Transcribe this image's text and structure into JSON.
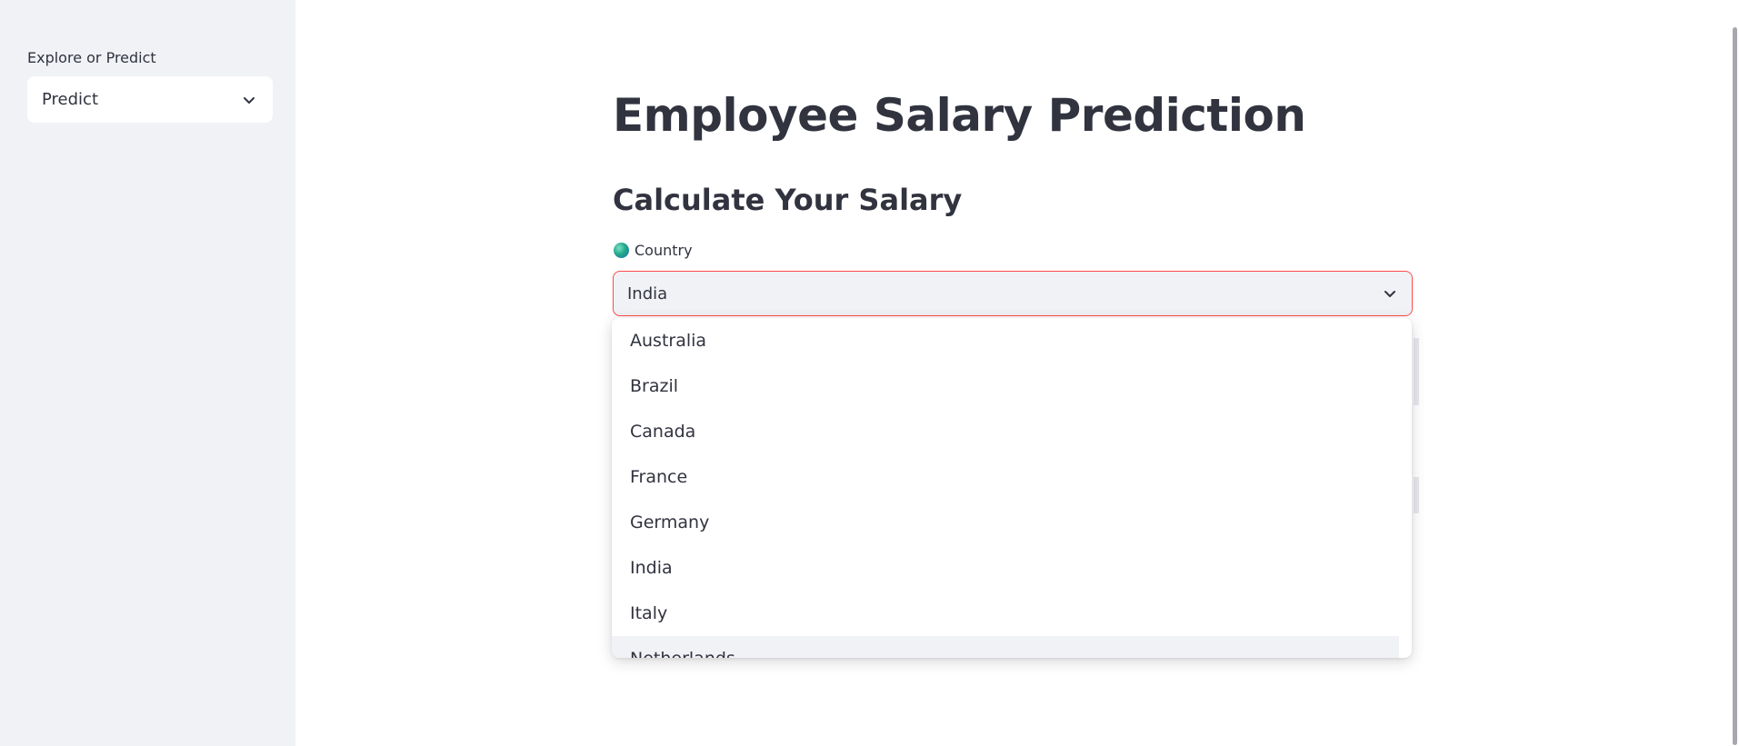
{
  "sidebar": {
    "label": "Explore or Predict",
    "selected": "Predict",
    "icon": "chevron-down-icon"
  },
  "main": {
    "title": "Employee Salary Prediction",
    "subtitle": "Calculate Your Salary",
    "country_field": {
      "icon": "globe-icon",
      "label": "Country",
      "value": "India",
      "options": [
        "Australia",
        "Brazil",
        "Canada",
        "France",
        "Germany",
        "India",
        "Italy",
        "Netherlands"
      ]
    }
  },
  "colors": {
    "accent_border": "#ff4b4b",
    "sidebar_bg": "#f0f2f6",
    "text": "#31333f"
  }
}
